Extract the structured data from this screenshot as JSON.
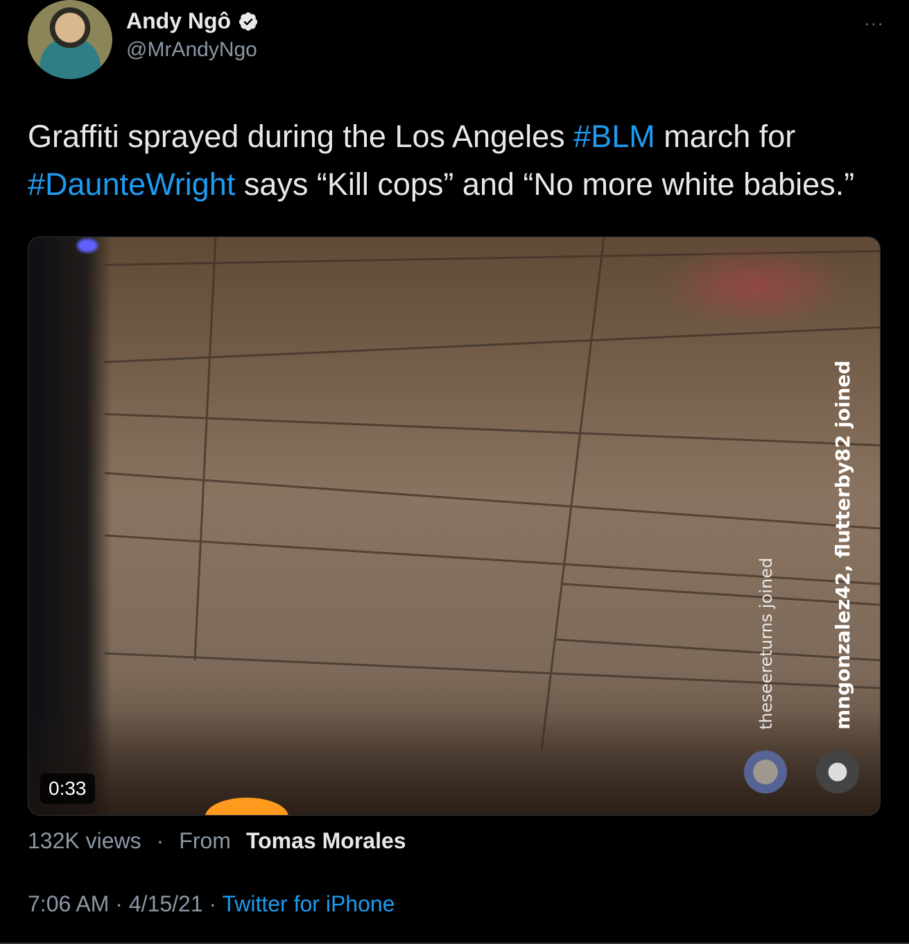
{
  "author": {
    "name": "Andy Ngô",
    "handle": "@MrAndyNgo",
    "more_label": "···"
  },
  "tweet": {
    "text_parts": [
      "Graffiti sprayed during the Los Angeles ",
      "#BLM",
      " march for ",
      "#DaunteWright",
      " says “Kill cops” and “No more white babies.”"
    ]
  },
  "media": {
    "duration": "0:33",
    "overlay_joined_1": "theseereturns joined",
    "overlay_joined_2": "mngonzalez42, flutterby82 joined"
  },
  "stats": {
    "views": "132K views",
    "separator": "·",
    "from_label": "From",
    "from_name": "Tomas Morales"
  },
  "meta": {
    "time": "7:06 AM",
    "sep1": " · ",
    "date": "4/15/21",
    "sep2": " · ",
    "source": "Twitter for iPhone"
  },
  "colors": {
    "background": "#000000",
    "accent": "#1d9bf0",
    "secondary_text": "#8b98a5"
  },
  "icons": [
    "verified-badge-icon",
    "more-options-icon"
  ]
}
